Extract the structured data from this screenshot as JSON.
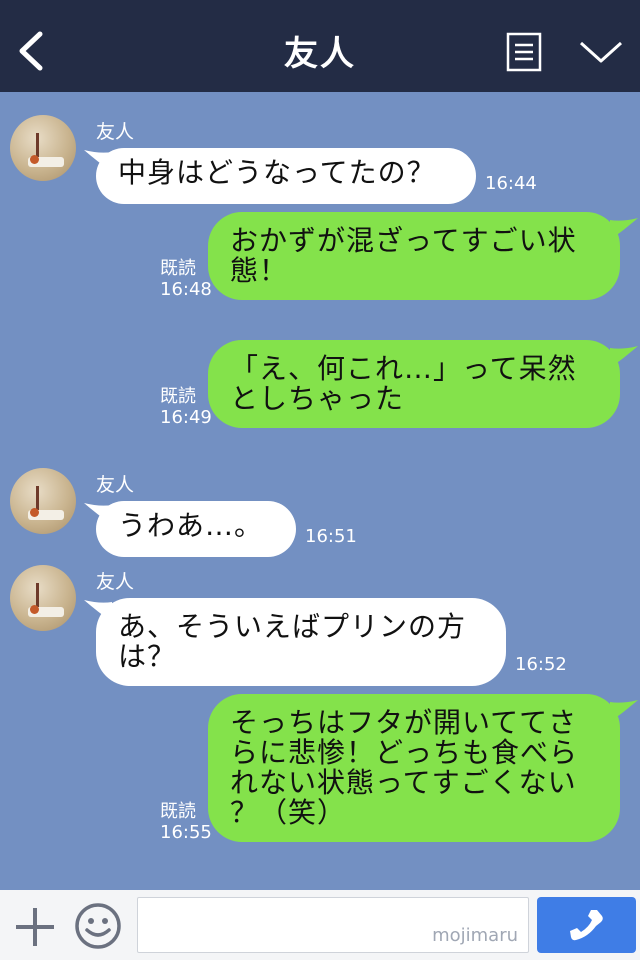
{
  "header": {
    "title": "友人",
    "icons": [
      "chevron-left-icon",
      "menu-list-icon",
      "chevron-down-icon"
    ]
  },
  "messages": [
    {
      "side": "in",
      "sender": "友人",
      "text": "中身はどうなってたの？",
      "time": "16:44"
    },
    {
      "side": "out",
      "read": "既読",
      "time": "16:48",
      "lines": [
        "おかずが混ざってすごい状",
        "態！"
      ]
    },
    {
      "side": "out",
      "read": "既読",
      "time": "16:49",
      "lines": [
        "「え、何これ…」って呆然",
        "としちゃった"
      ]
    },
    {
      "side": "in",
      "sender": "友人",
      "text": "うわあ…。",
      "time": "16:51"
    },
    {
      "side": "in",
      "sender": "友人",
      "lines": [
        "あ、そういえばプリンの方",
        "は？"
      ],
      "time": "16:52"
    },
    {
      "side": "out",
      "read": "既読",
      "time": "16:55",
      "lines": [
        "そっちはフタが開いててさ",
        "らに悲惨！どっちも食べら",
        "れない状態ってすごくない",
        "？（笑）"
      ]
    }
  ],
  "bottom_bar": {
    "input_placeholder": "",
    "watermark": "mojimaru",
    "icons": [
      "plus-icon",
      "smiley-icon",
      "phone-icon"
    ]
  },
  "colors": {
    "header_bg": "#232c45",
    "chat_bg": "#7390c2",
    "incoming_bubble": "#ffffff",
    "outgoing_bubble": "#84e24b",
    "call_button": "#3f7de6"
  }
}
